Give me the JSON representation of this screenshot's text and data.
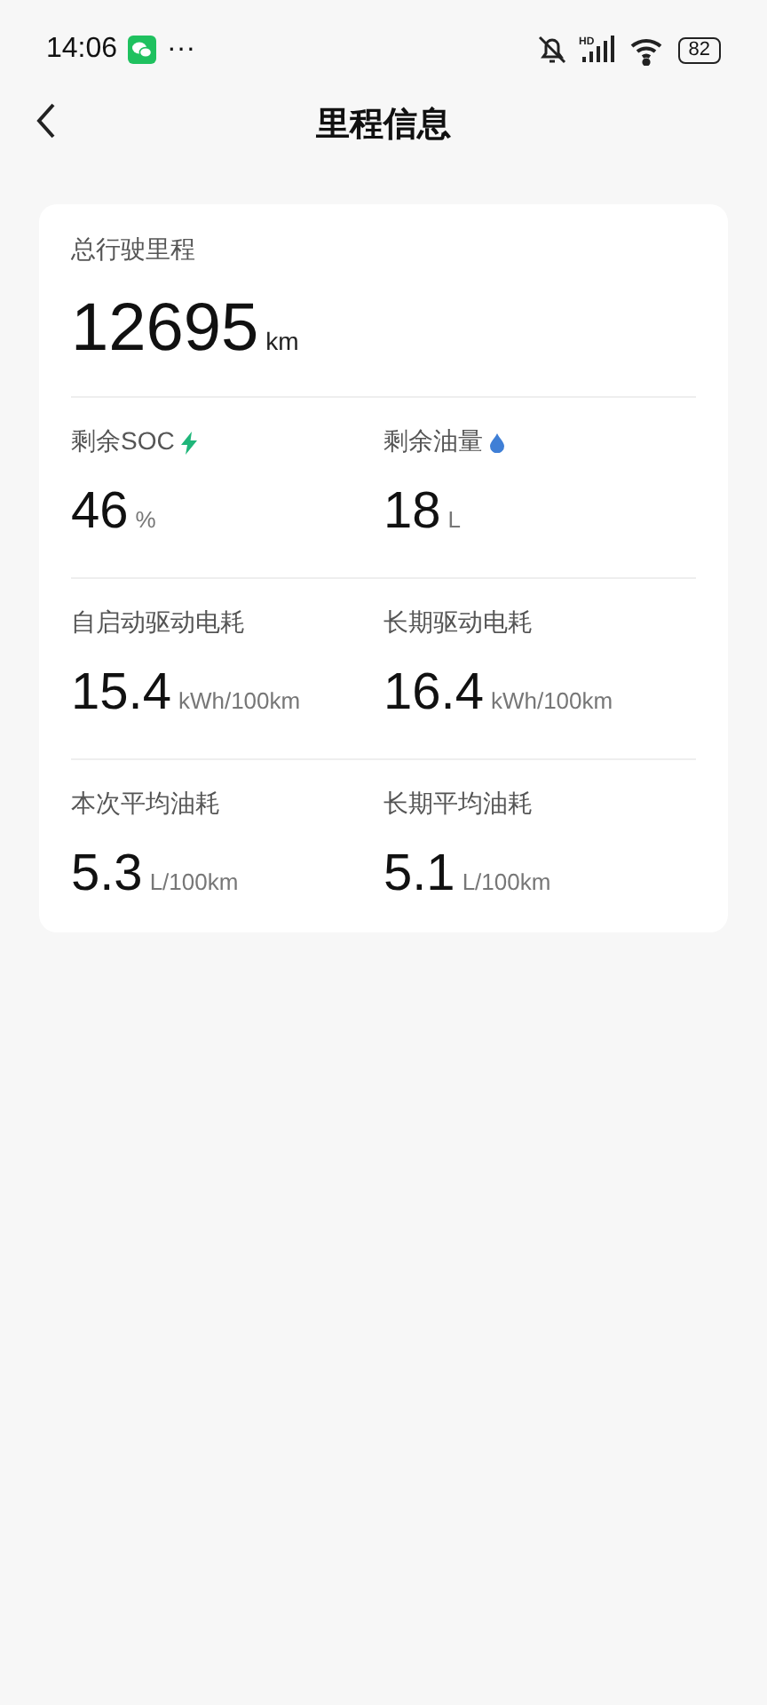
{
  "status_bar": {
    "time": "14:06",
    "more": "···",
    "network": "HD",
    "battery": "82"
  },
  "header": {
    "title": "里程信息"
  },
  "total": {
    "label": "总行驶里程",
    "value": "12695",
    "unit": "km"
  },
  "metrics": [
    [
      {
        "label": "剩余SOC",
        "kind": "bolt",
        "value": "46",
        "unit": "%"
      },
      {
        "label": "剩余油量",
        "kind": "drop",
        "value": "18",
        "unit": "L"
      }
    ],
    [
      {
        "label": "自启动驱动电耗",
        "value": "15.4",
        "unit": "kWh/100km"
      },
      {
        "label": "长期驱动电耗",
        "value": "16.4",
        "unit": "kWh/100km"
      }
    ],
    [
      {
        "label": "本次平均油耗",
        "value": "5.3",
        "unit": "L/100km"
      },
      {
        "label": "长期平均油耗",
        "value": "5.1",
        "unit": "L/100km"
      }
    ]
  ]
}
